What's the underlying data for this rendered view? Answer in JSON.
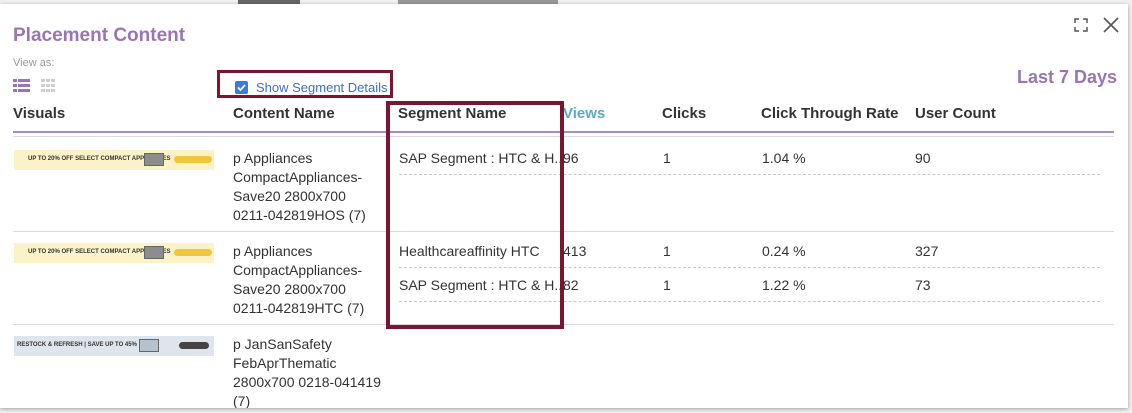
{
  "modal": {
    "title": "Placement Content",
    "view_as_label": "View as:",
    "show_segment_details_label": "Show Segment Details",
    "show_segment_details_checked": true,
    "date_range": "Last 7 Days"
  },
  "columns": {
    "visuals": "Visuals",
    "content_name": "Content Name",
    "segment_name": "Segment Name",
    "views": "Views",
    "clicks": "Clicks",
    "ctr": "Click Through Rate",
    "user_count": "User Count"
  },
  "rows": [
    {
      "banner_text": "UP TO 20% OFF SELECT COMPACT APPLIANCES",
      "content_name": "p Appliances CompactAppliances-Save20 2800x700 0211-042819HOS (7)",
      "segments": [
        {
          "name": "SAP Segment : HTC & H...",
          "views": "96",
          "clicks": "1",
          "ctr": "1.04 %",
          "user_count": "90"
        }
      ]
    },
    {
      "banner_text": "UP TO 20% OFF SELECT COMPACT APPLIANCES",
      "content_name": "p Appliances CompactAppliances-Save20 2800x700 0211-042819HTC (7)",
      "segments": [
        {
          "name": "Healthcareaffinity HTC",
          "views": "413",
          "clicks": "1",
          "ctr": "0.24 %",
          "user_count": "327"
        },
        {
          "name": "SAP Segment : HTC & H...",
          "views": "82",
          "clicks": "1",
          "ctr": "1.22 %",
          "user_count": "73"
        }
      ]
    },
    {
      "banner_text": "RESTOCK & REFRESH | SAVE UP TO 45%",
      "content_name": "p JanSanSafety FebAprThematic 2800x700 0218-041419 (7)",
      "segments": []
    }
  ],
  "colors": {
    "accent_purple": "#9b74b4",
    "highlight_border": "#7b1530",
    "views_header": "#5aa9c9",
    "checkbox": "#3b7bd9"
  },
  "icons": {
    "maximize": "maximize-icon",
    "close": "close-icon",
    "list_view": "list-view-icon",
    "grid_view": "grid-view-icon",
    "checkbox": "checkbox-checked-icon"
  }
}
